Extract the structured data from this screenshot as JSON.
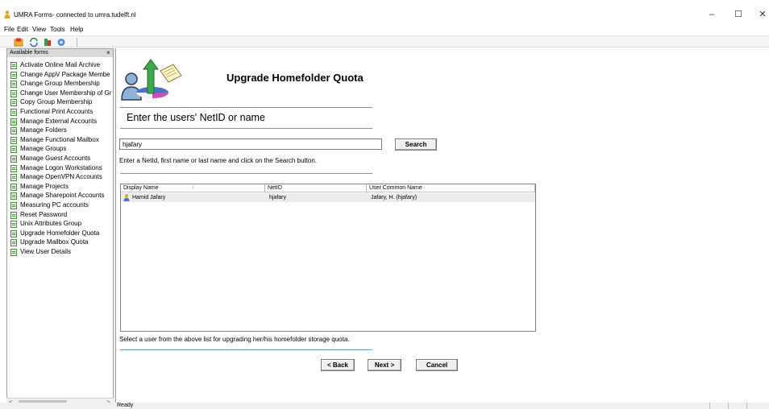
{
  "window": {
    "title": "UMRA Forms- connected to umra.tudelft.nl",
    "controls": {
      "minimize": "–",
      "maximize": "☐",
      "close": "✕"
    }
  },
  "menu": {
    "items": [
      "File",
      "Edit",
      "View",
      "Tools",
      "Help"
    ]
  },
  "toolbar": {
    "icons": [
      "open-form-icon",
      "refresh-icon",
      "connect-icon",
      "settings-icon"
    ]
  },
  "sidebar": {
    "title": "Available forms",
    "close_glyph": "×",
    "items": [
      {
        "label": "Activate Online Mail Archive"
      },
      {
        "label": "Change AppV Package Membe"
      },
      {
        "label": "Change Group Membership"
      },
      {
        "label": "Change User Membership of Gr"
      },
      {
        "label": "Copy Group Membership"
      },
      {
        "label": "Functional Print Accounts"
      },
      {
        "label": "Manage External Accounts"
      },
      {
        "label": "Manage Folders"
      },
      {
        "label": "Manage Functional Mailbox"
      },
      {
        "label": "Manage Groups"
      },
      {
        "label": "Manage Guest Accounts"
      },
      {
        "label": "Manage Logon Workstations"
      },
      {
        "label": "Manage OpenVPN Accounts"
      },
      {
        "label": "Manage Projects"
      },
      {
        "label": "Manage Sharepoint Accounts"
      },
      {
        "label": "Measuring PC accounts"
      },
      {
        "label": "Reset Password"
      },
      {
        "label": "Unix Attributes Group"
      },
      {
        "label": "Upgrade Homefolder Quota"
      },
      {
        "label": "Upgrade Mailbox Quota"
      },
      {
        "label": "View User Details"
      }
    ],
    "scroll_left": "<",
    "scroll_right": ">"
  },
  "form": {
    "title": "Upgrade Homefolder Quota",
    "section_heading": "Enter the users' NetID or name",
    "search": {
      "value": "hjafary",
      "button": "Search",
      "hint": "Enter a NetId, first name or last name and click on the Search button."
    },
    "results": {
      "columns": [
        "Display Name",
        "NetID",
        "User Common Name"
      ],
      "sort_glyph": "/",
      "rows": [
        {
          "display_name": "Hamid Jafary",
          "netid": "hjafary",
          "common_name": "Jafary, H. (hjafary)"
        }
      ]
    },
    "select_hint": "Select a user from the above list for upgrading her/his homefolder storage quota.",
    "buttons": {
      "back": "< Back",
      "next": "Next >",
      "cancel": "Cancel"
    }
  },
  "status": {
    "text": "Ready"
  },
  "colors": {
    "rule": "#6a9ac4",
    "selected_row": "#ececec",
    "form_icon": "#4c8a43"
  }
}
